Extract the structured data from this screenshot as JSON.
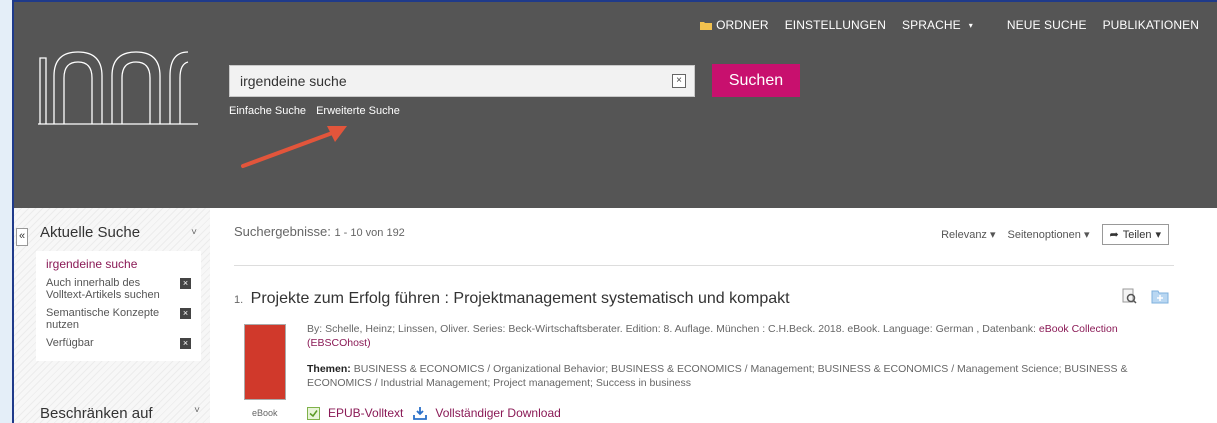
{
  "topnav": {
    "folder": "ORDNER",
    "settings": "EINSTELLUNGEN",
    "language": "SPRACHE",
    "new_search": "NEUE SUCHE",
    "publications": "PUBLIKATIONEN"
  },
  "search": {
    "value": "irgendeine suche",
    "button": "Suchen",
    "basic": "Einfache Suche",
    "advanced": "Erweiterte Suche"
  },
  "sidebar": {
    "current_title": "Aktuelle Suche",
    "current_query": "irgendeine suche",
    "filters": [
      "Auch innerhalb des Volltext-Artikels suchen",
      "Semantische Konzepte nutzen",
      "Verfügbar"
    ],
    "limit_title": "Beschränken auf"
  },
  "results": {
    "label": "Suchergebnisse:",
    "range": "1 - 10 von 192",
    "sort": "Relevanz",
    "page_options": "Seitenoptionen",
    "share": "Teilen"
  },
  "result1": {
    "num": "1.",
    "title": "Projekte zum Erfolg führen : Projektmanagement systematisch und kompakt",
    "meta": "By: Schelle, Heinz; Linssen, Oliver. Series: Beck-Wirtschaftsberater. Edition: 8. Auflage. München : C.H.Beck. 2018. eBook. Language: German , Datenbank:",
    "db_link": "eBook Collection (EBSCOhost)",
    "themes_label": "Themen:",
    "themes": "BUSINESS & ECONOMICS / Organizational Behavior; BUSINESS & ECONOMICS / Management; BUSINESS & ECONOMICS / Management Science; BUSINESS & ECONOMICS / Industrial Management; Project management; Success in business",
    "type": "eBook",
    "epub": "EPUB-Volltext",
    "download": "Vollständiger Download"
  },
  "colors": {
    "header": "#555555",
    "accent": "#c8106e",
    "link": "#8a1a56"
  }
}
